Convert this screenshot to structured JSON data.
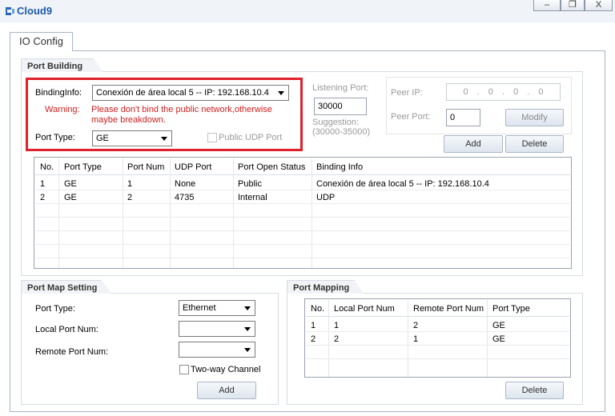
{
  "window": {
    "title": "Cloud9",
    "minimize": "–",
    "restore": "❐",
    "close": "X"
  },
  "tabs": [
    {
      "label": "IO Config"
    }
  ],
  "port_building": {
    "title": "Port Building",
    "binding_label": "BindingInfo:",
    "binding_value": "Conexión de área local 5 -- IP: 192.168.10.4",
    "warning_label": "Warning:",
    "warning_text": "Please don't bind the public network,otherwise maybe breakdown.",
    "port_type_label": "Port Type:",
    "port_type_value": "GE",
    "public_udp_label": "Public UDP Port",
    "public_udp_checked": false,
    "listening_port_label": "Listening Port:",
    "listening_port_value": "30000",
    "suggestion_label": "Suggestion:",
    "suggestion_range": "(30000-35000)",
    "peer_ip_label": "Peer IP:",
    "peer_ip_value": "0 . 0 . 0 . 0",
    "peer_port_label": "Peer Port:",
    "peer_port_value": "0",
    "modify_label": "Modify",
    "add_label": "Add",
    "delete_label": "Delete",
    "table": {
      "columns": [
        "No.",
        "Port Type",
        "Port Num",
        "UDP Port",
        "Port Open Status",
        "Binding Info"
      ],
      "rows": [
        [
          "1",
          "GE",
          "1",
          "None",
          "Public",
          "Conexión de área local 5 -- IP: 192.168.10.4"
        ],
        [
          "2",
          "GE",
          "2",
          "4735",
          "Internal",
          "UDP"
        ]
      ]
    }
  },
  "port_map_setting": {
    "title": "Port Map Setting",
    "port_type_label": "Port Type:",
    "port_type_value": "Ethernet",
    "local_port_label": "Local Port Num:",
    "local_port_value": "",
    "remote_port_label": "Remote Port Num:",
    "remote_port_value": "",
    "two_way_label": "Two-way Channel",
    "two_way_checked": false,
    "add_label": "Add"
  },
  "port_mapping": {
    "title": "Port Mapping",
    "columns": [
      "No.",
      "Local Port Num",
      "Remote Port Num",
      "Port Type"
    ],
    "rows": [
      [
        "1",
        "1",
        "2",
        "GE"
      ],
      [
        "2",
        "2",
        "1",
        "GE"
      ]
    ],
    "delete_label": "Delete"
  },
  "colors": {
    "highlight": "#e0202a",
    "warning": "#d02020",
    "title": "#1f5aa6"
  }
}
